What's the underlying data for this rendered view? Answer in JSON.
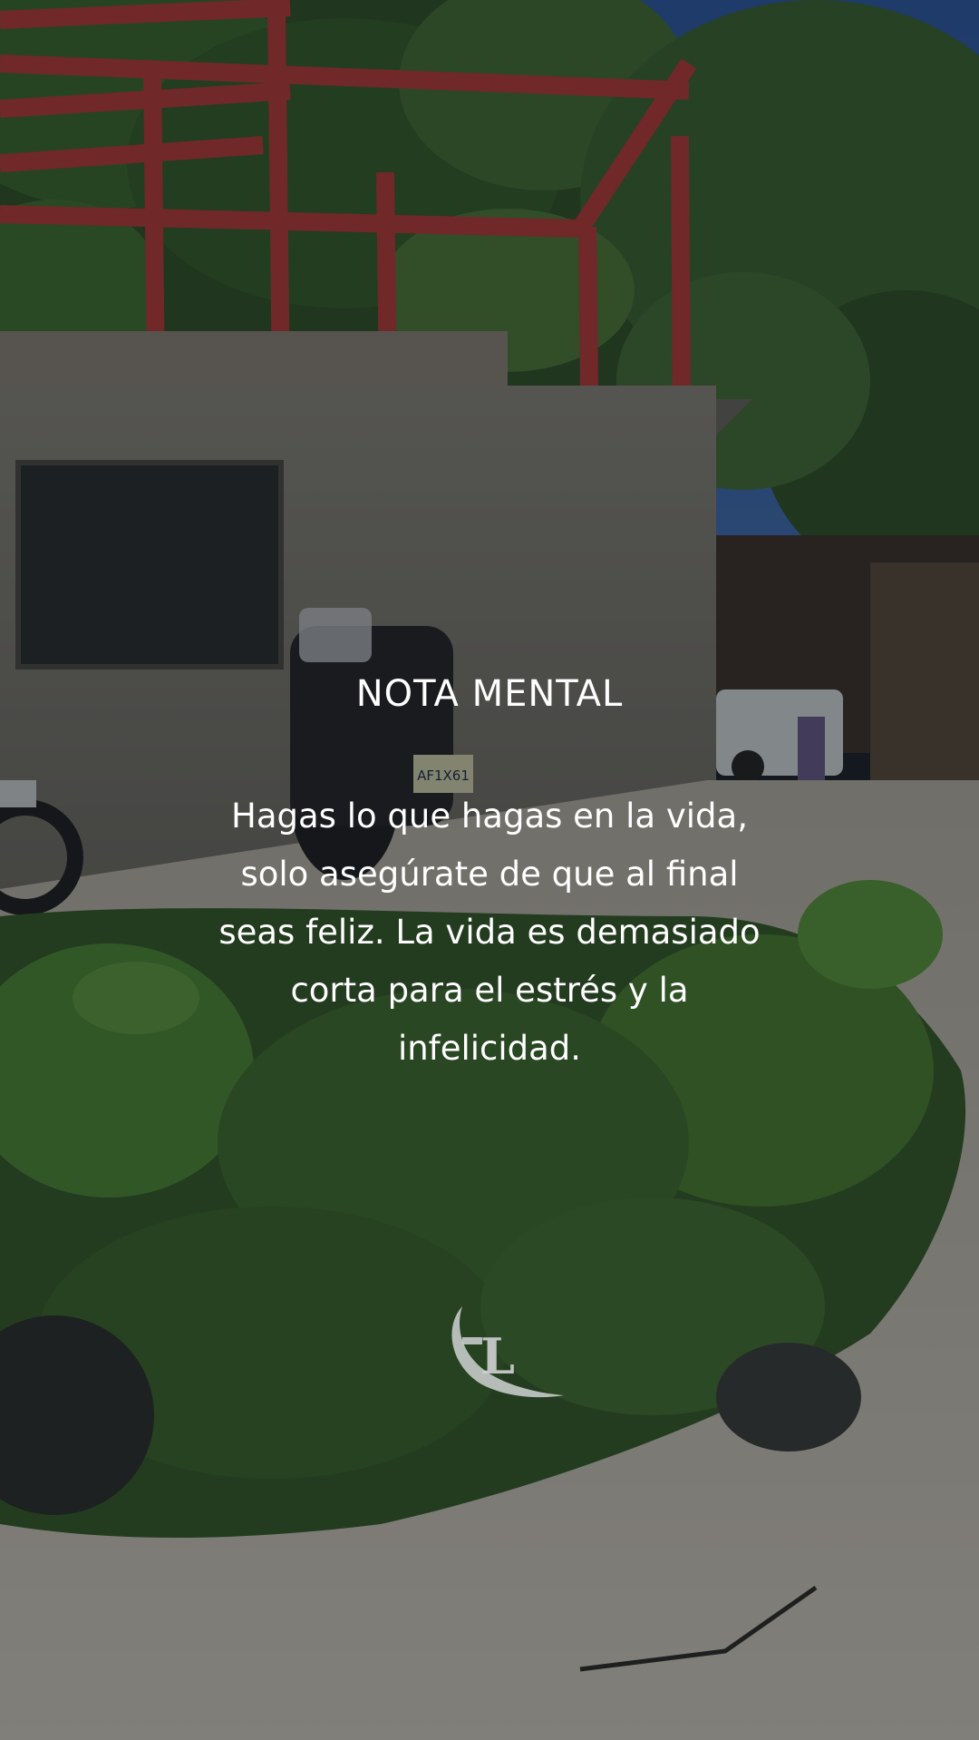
{
  "overlay": {
    "title": "NOTA MENTAL",
    "quote": "Hagas lo que hagas en la vida, solo asegúrate de que al final seas feliz. La vida es demasiado corta para el estrés y la infelicidad."
  },
  "plate_text": "AF1X61",
  "colors": {
    "text": "#ffffff",
    "frame_red": "#b83a36",
    "wall": "#7d7a72",
    "foliage": "#3e6a2e",
    "path": "#c9c2b4"
  },
  "icons": [
    "watermark-logo-icon"
  ]
}
